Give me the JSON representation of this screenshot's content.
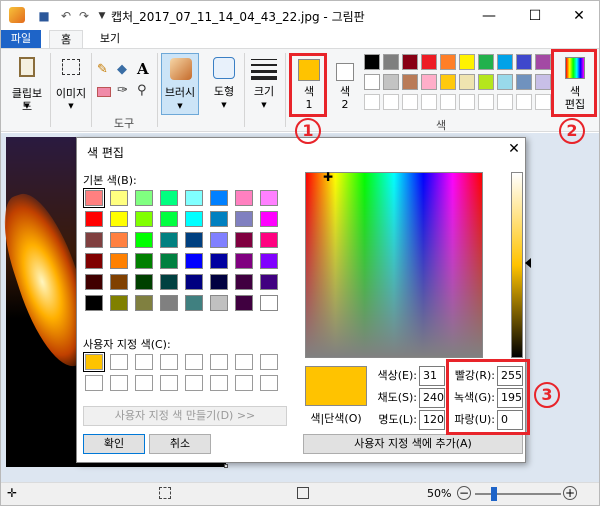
{
  "window": {
    "title": "캡처_2017_07_11_14_04_43_22.jpg - 그림판",
    "minimize": "—",
    "maximize": "☐",
    "close": "✕"
  },
  "tabs": {
    "file": "파일",
    "home": "홈",
    "view": "보기"
  },
  "ribbon": {
    "clipboard": "클립보드",
    "image": "이미지",
    "tools_label": "도구",
    "brushes": "브러시",
    "shapes": "도형",
    "size": "크기",
    "color1_line1": "색",
    "color1_line2": "1",
    "color2_line1": "색",
    "color2_line2": "2",
    "colors_group_label": "색",
    "edit_colors_line1": "색",
    "edit_colors_line2": "편집",
    "color1_value": "#ffc300",
    "palette_row1": [
      "#000000",
      "#7f7f7f",
      "#880015",
      "#ed1c24",
      "#ff7f27",
      "#fff200",
      "#22b14c",
      "#00a2e8",
      "#3f48cc",
      "#a349a4"
    ],
    "palette_row2": [
      "#ffffff",
      "#c3c3c3",
      "#b97a57",
      "#ffaec9",
      "#ffc90e",
      "#efe4b0",
      "#b5e61d",
      "#99d9ea",
      "#7092be",
      "#c8bfe7"
    ]
  },
  "dialog": {
    "title": "색 편집",
    "close": "✕",
    "basic_colors_label": "기본 색(B):",
    "custom_colors_label": "사용자 지정 색(C):",
    "define_custom_button": "사용자 지정 색 만들기(D) >>",
    "ok_button": "확인",
    "cancel_button": "취소",
    "color_solid_label": "색|단색(O)",
    "add_custom_button": "사용자 지정 색에 추가(A)",
    "hue_label": "색상(E):",
    "hue_value": "31",
    "sat_label": "채도(S):",
    "sat_value": "240",
    "lum_label": "명도(L):",
    "lum_value": "120",
    "red_label": "빨강(R):",
    "red_value": "255",
    "green_label": "녹색(G):",
    "green_value": "195",
    "blue_label": "파랑(U):",
    "blue_value": "0",
    "preview_color": "#ffc300",
    "basic_colors": [
      [
        "#ff8080",
        "#ffff80",
        "#80ff80",
        "#00ff80",
        "#80ffff",
        "#0080ff",
        "#ff80c0",
        "#ff80ff"
      ],
      [
        "#ff0000",
        "#ffff00",
        "#80ff00",
        "#00ff40",
        "#00ffff",
        "#0080c0",
        "#8080c0",
        "#ff00ff"
      ],
      [
        "#804040",
        "#ff8040",
        "#00ff00",
        "#008080",
        "#004080",
        "#8080ff",
        "#800040",
        "#ff0080"
      ],
      [
        "#800000",
        "#ff8000",
        "#008000",
        "#008040",
        "#0000ff",
        "#0000a0",
        "#800080",
        "#8000ff"
      ],
      [
        "#400000",
        "#804000",
        "#004000",
        "#004040",
        "#000080",
        "#000040",
        "#400040",
        "#400080"
      ],
      [
        "#000000",
        "#808000",
        "#808040",
        "#808080",
        "#408080",
        "#c0c0c0",
        "#400040",
        "#ffffff"
      ]
    ],
    "custom_first": "#ffc300"
  },
  "callouts": {
    "one": "1",
    "two": "2",
    "three": "3"
  },
  "status": {
    "zoom": "50%"
  }
}
